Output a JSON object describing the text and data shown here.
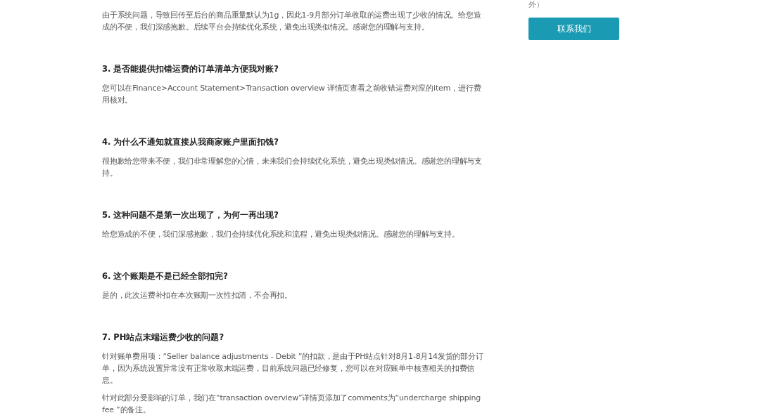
{
  "article": {
    "intro_paragraphs": [
      "由于系统问题，导致回传至后台的商品重量默认为1g，因此1-9月部分订单收取的运费出现了少收的情况。给您造成的不便，我们深感抱歉。后续平台会持续优化系统，避免出现类似情况。感谢您的理解与支持。"
    ],
    "faqs": [
      {
        "question": "3. 是否能提供扣错运费的订单清单方便我对账?",
        "answers": [
          "您可以在Finance>Account Statement>Transaction overview 详情页查看之前收错运费对应的item，进行费用核对。"
        ]
      },
      {
        "question": "4. 为什么不通知就直接从我商家账户里面扣钱?",
        "answers": [
          "很抱歉给您带来不便，我们非常理解您的心情，未来我们会持续优化系统，避免出现类似情况。感谢您的理解与支持。"
        ]
      },
      {
        "question": "5. 这种问题不是第一次出现了，为何一再出现?",
        "answers": [
          "给您造成的不便，我们深感抱歉，我们会持续优化系统和流程，避免出现类似情况。感谢您的理解与支持。"
        ]
      },
      {
        "question": "6. 这个账期是不是已经全部扣完?",
        "answers": [
          "是的，此次运费补扣在本次账期一次性扣清，不会再扣。"
        ]
      },
      {
        "question": "7. PH站点末端运费少收的问题?",
        "answers": [
          "针对账单费用项：“Seller balance adjustments - Debit ”的扣款，是由于PH站点针对8月1-8月14发货的部分订单，因为系统设置异常没有正常收取末端运费，目前系统问题已经修复，您可以在对应账单中核查相关的扣费信息。",
          "针对此部分受影响的订单，我们在“transaction overview”详情页添加了comments为“undercharge shipping fee ”的备注。"
        ]
      }
    ]
  },
  "sidebar": {
    "note_fragment": "外）",
    "contact_button": "联系我们"
  }
}
